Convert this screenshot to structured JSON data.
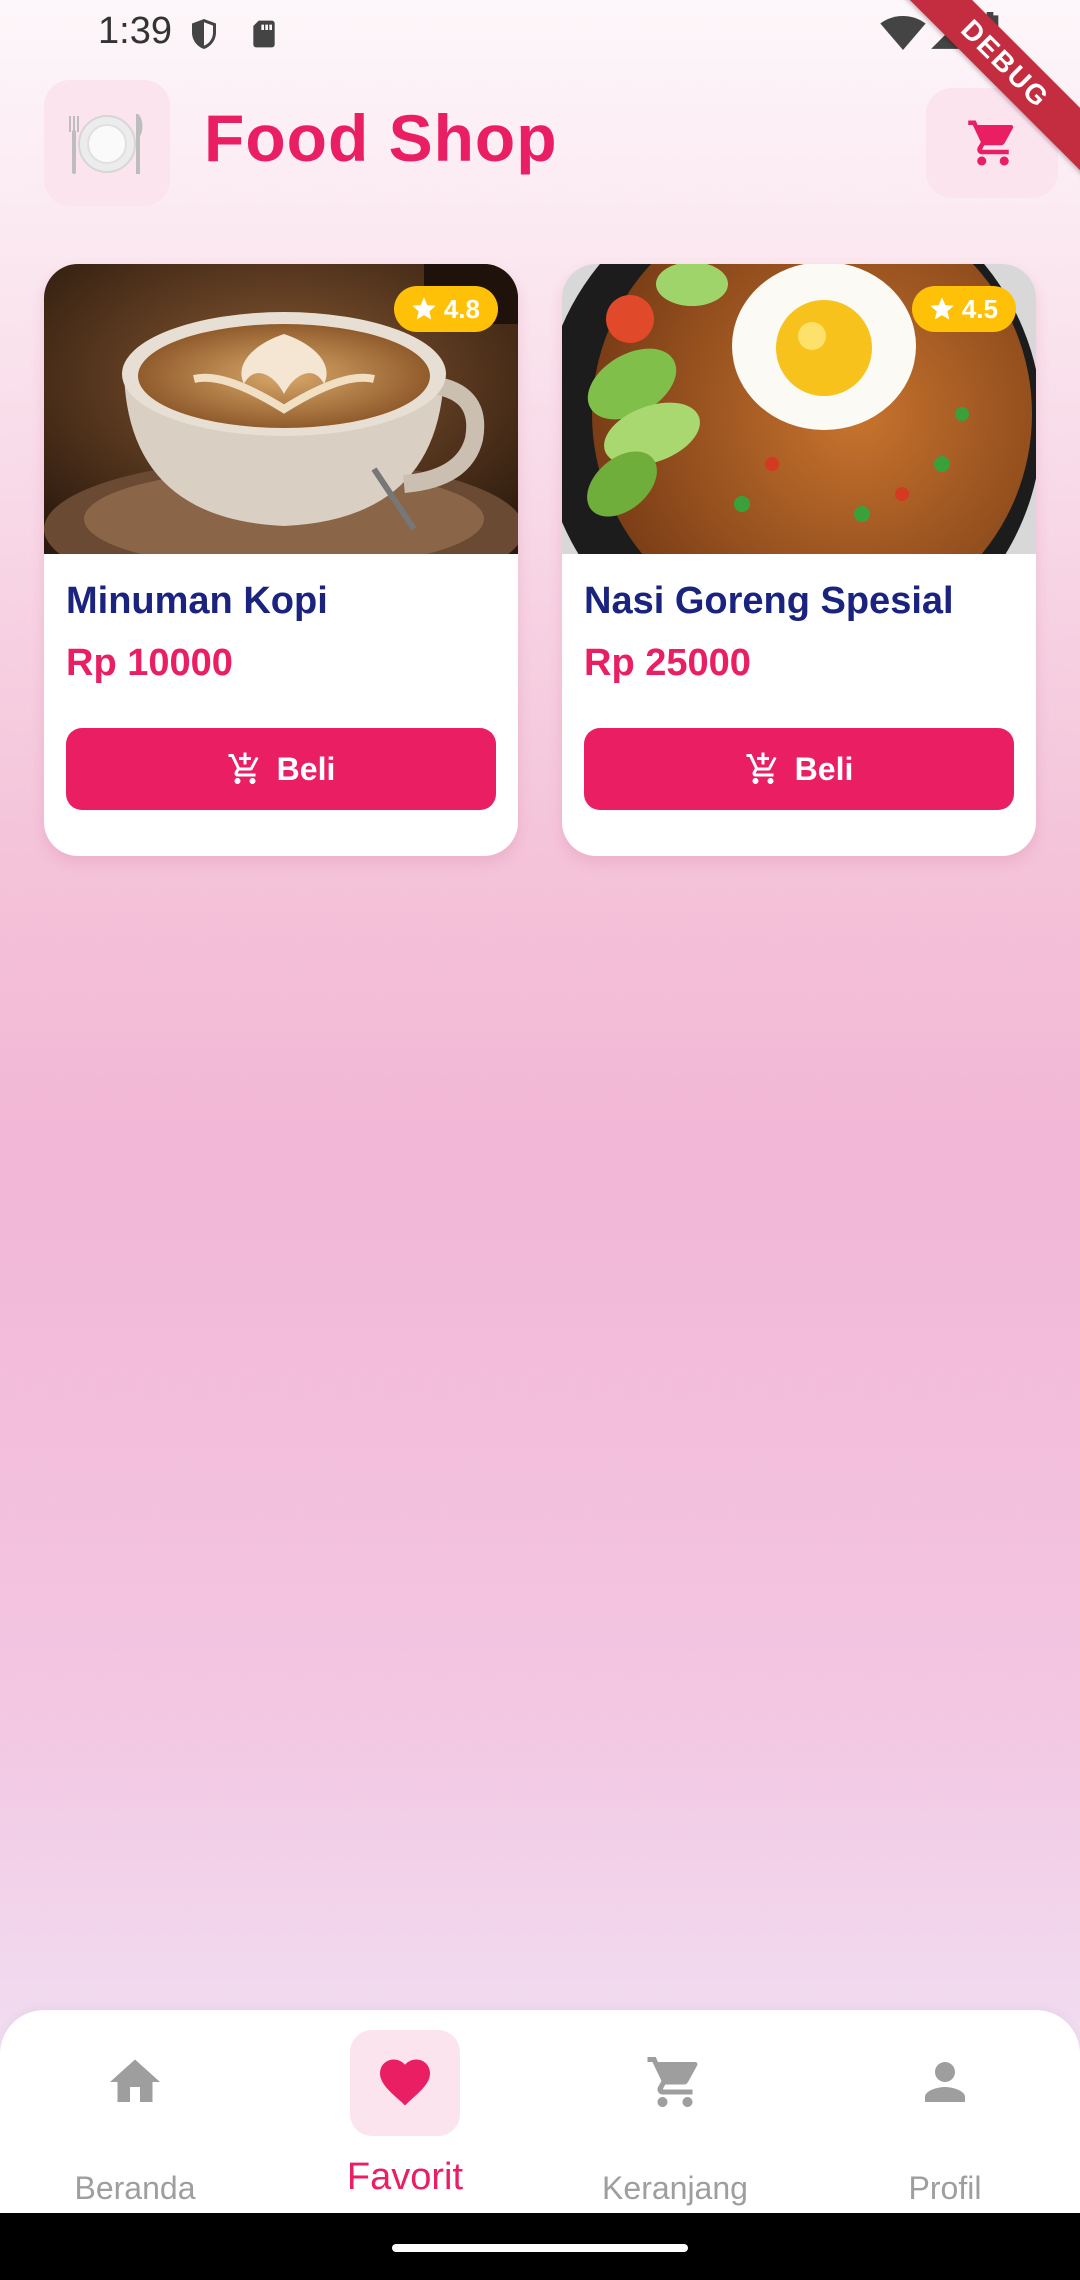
{
  "status_bar": {
    "time": "1:39",
    "icons": [
      "shield-icon",
      "sd-card-icon",
      "wifi-icon",
      "signal-icon",
      "battery-icon"
    ]
  },
  "debug_banner": "DEBUG",
  "header": {
    "title": "Food Shop",
    "logo_icon": "plate-cutlery-icon",
    "cart_icon": "cart-icon"
  },
  "products": [
    {
      "name": "Minuman Kopi",
      "price": "Rp 10000",
      "rating": "4.8",
      "button": "Beli",
      "image": "latte-coffee-cup"
    },
    {
      "name": "Nasi Goreng Spesial",
      "price": "Rp 25000",
      "rating": "4.5",
      "button": "Beli",
      "image": "fried-rice-with-egg"
    }
  ],
  "nav": {
    "items": [
      {
        "label": "Beranda",
        "icon": "home-icon"
      },
      {
        "label": "Favorit",
        "icon": "heart-icon",
        "active": true
      },
      {
        "label": "Keranjang",
        "icon": "cart-icon"
      },
      {
        "label": "Profil",
        "icon": "person-icon"
      }
    ]
  },
  "colors": {
    "accent": "#e91e63",
    "title_blue": "#1a237e",
    "rating": "#ffc107",
    "inactive": "#9e9e9e"
  }
}
